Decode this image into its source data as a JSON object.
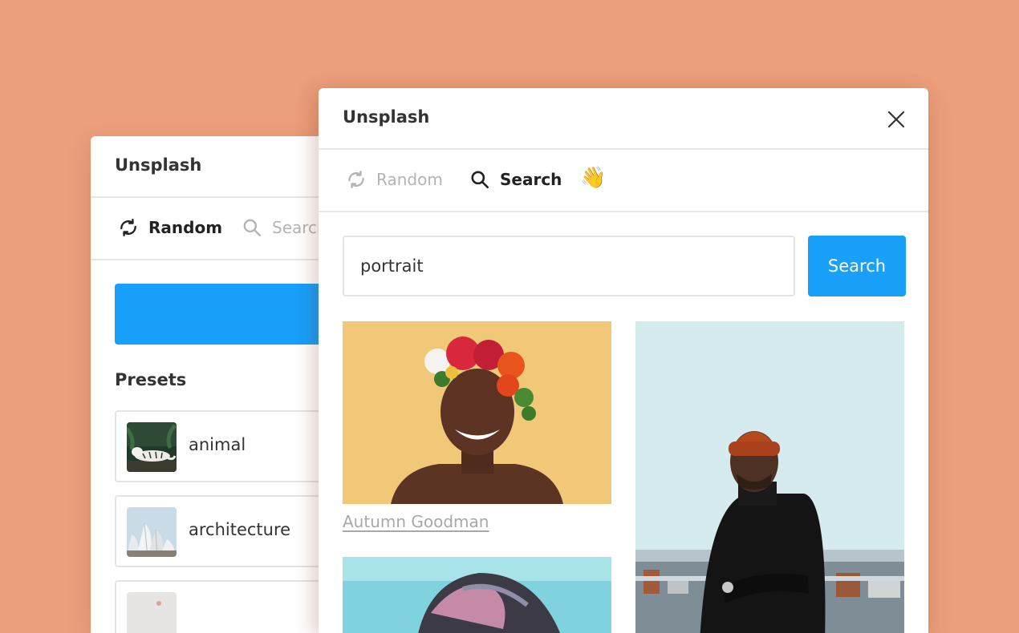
{
  "back_panel": {
    "title": "Unsplash",
    "tabs": [
      {
        "label": "Random",
        "icon": "refresh-icon",
        "active": true
      },
      {
        "label": "Search",
        "icon": "search-icon",
        "active": false
      }
    ],
    "presets_heading": "Presets",
    "presets": [
      {
        "label": "animal",
        "icon": "tiger-thumbnail"
      },
      {
        "label": "architecture",
        "icon": "opera-house-thumbnail"
      },
      {
        "label": "",
        "icon": "preset-thumbnail"
      }
    ]
  },
  "front_panel": {
    "title": "Unsplash",
    "tabs": [
      {
        "label": "Random",
        "icon": "refresh-icon",
        "active": false
      },
      {
        "label": "Search",
        "icon": "search-icon",
        "active": true
      },
      {
        "label": "👋",
        "icon": "waving-hand-icon",
        "active": false
      }
    ],
    "search": {
      "value": "portrait",
      "button_label": "Search"
    },
    "results": [
      {
        "credit": "Autumn Goodman",
        "subject": "woman-with-flower-crown"
      },
      {
        "credit": "",
        "subject": "man-in-beanie"
      },
      {
        "credit": "",
        "subject": "person-with-dyed-hair"
      }
    ]
  },
  "colors": {
    "background": "#EC9F7C",
    "accent": "#18A0FB",
    "inactive_text": "#B4B4B4",
    "text": "#333333"
  }
}
